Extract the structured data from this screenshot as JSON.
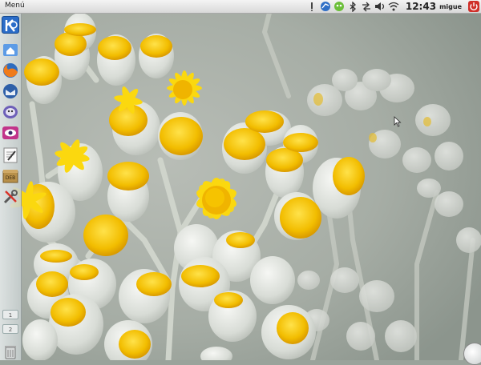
{
  "topbar": {
    "menu_label": "Menú",
    "clock": "12:43",
    "username": "migue",
    "indicators": [
      "info-icon",
      "browser-icon",
      "pidgin-icon",
      "bluetooth-icon",
      "network-icon",
      "volume-icon",
      "wifi-icon"
    ],
    "power_icon": "power-icon"
  },
  "launcher": {
    "items": [
      "kde-icon",
      "home-folder-icon",
      "firefox-icon",
      "thunderbird-icon",
      "pidgin-chat-icon",
      "eye-of-gnome-icon",
      "text-editor-icon",
      "deb-package-icon",
      "system-tools-icon"
    ],
    "workspaces": [
      "1",
      "2"
    ],
    "trash_icon": "trash-icon"
  },
  "colors": {
    "accent": "#f3c200",
    "panel": "#e6e6e6",
    "power": "#d0302a"
  }
}
